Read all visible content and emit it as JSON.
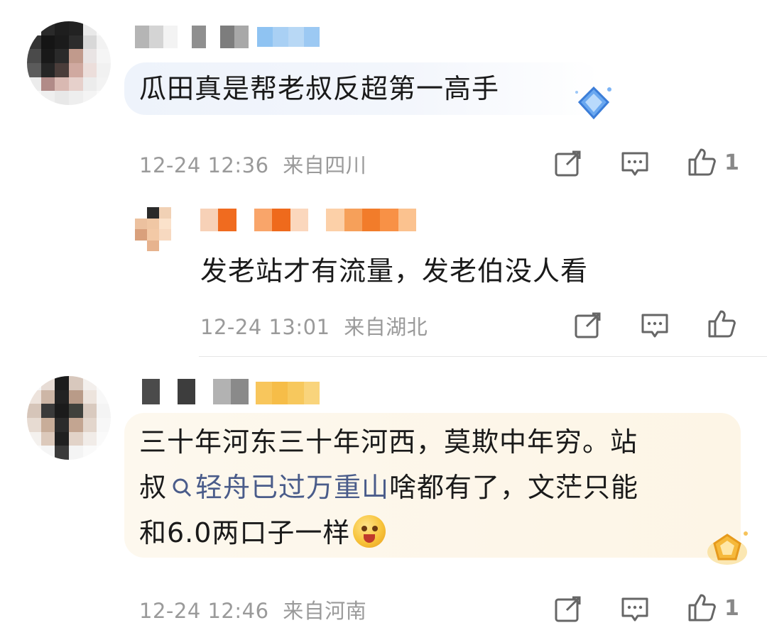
{
  "comments": [
    {
      "text": "瓜田真是帮老叔反超第一高手",
      "date": "12-24 12:36",
      "location": "来自四川",
      "likes": "1"
    },
    {
      "text": "发老站才有流量，发老伯没人看",
      "date": "12-24 13:01",
      "location": "来自湖北",
      "likes": ""
    },
    {
      "text_line1": "三十年河东三十年河西，莫欺中年穷。站",
      "text_line2_a": "叔",
      "hashtag": "轻舟已过万重山",
      "text_line2_b": "啥都有了，文茫只能",
      "text_line3": "和6.0两口子一样",
      "date": "12-24 12:46",
      "location": "来自河南",
      "likes": "1"
    }
  ],
  "icons": {
    "share": "share-icon",
    "reply": "comment-icon",
    "like": "thumbs-up-icon",
    "search": "search-icon"
  },
  "colors": {
    "meta_text": "#9a9a9a",
    "hashtag": "#4a5c8a",
    "bubble_blue": "#eef3fb",
    "bubble_gold": "#fdf6e8"
  }
}
